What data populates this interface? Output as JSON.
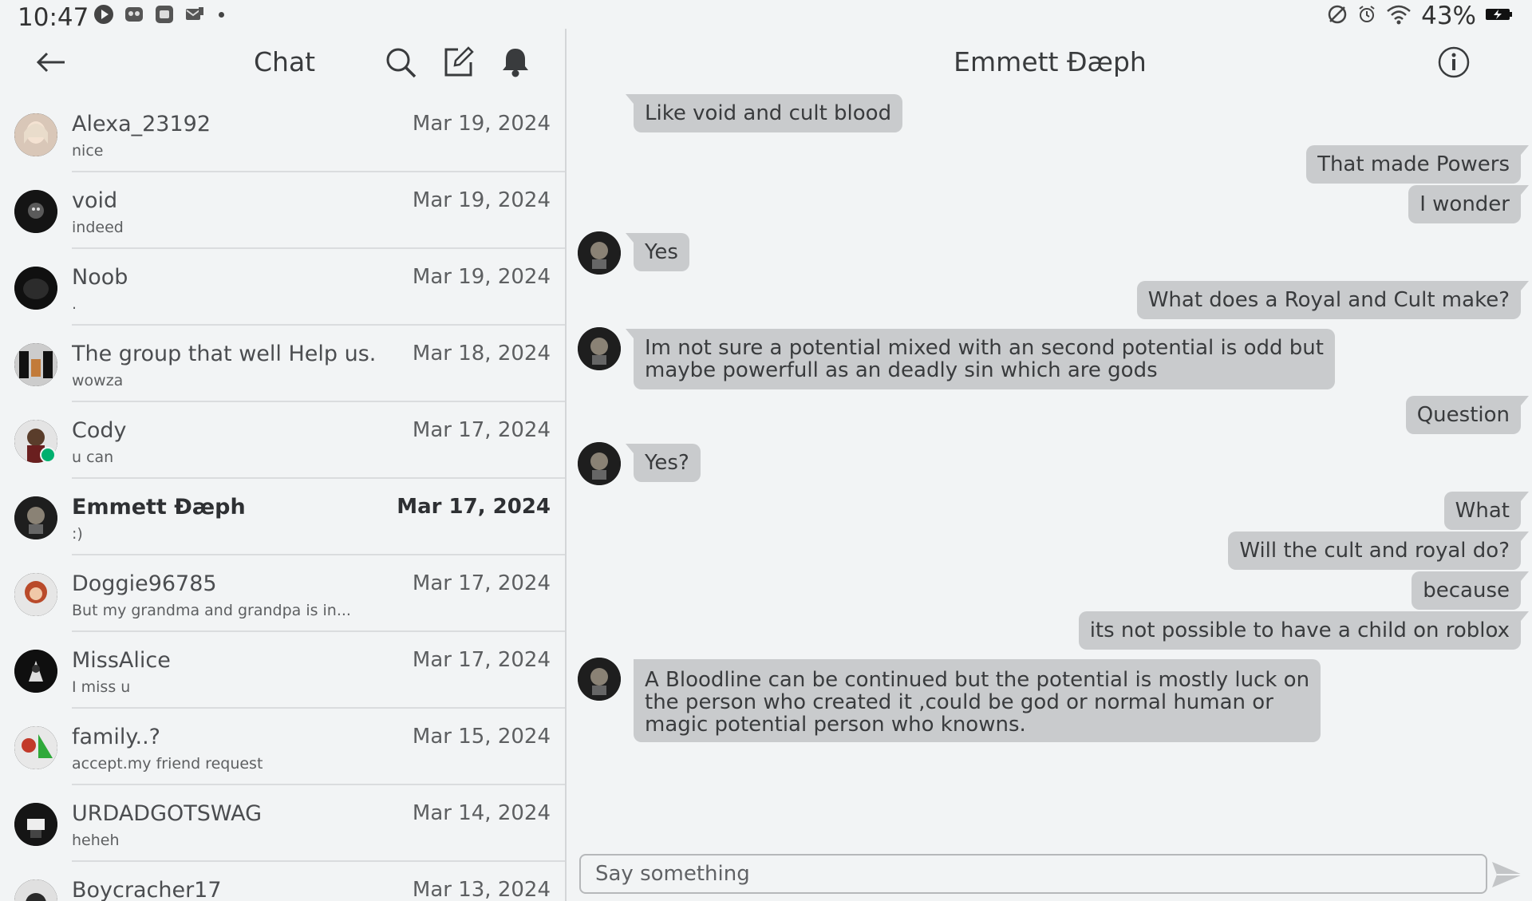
{
  "status_bar": {
    "time": "10:47",
    "battery_percent": "43%",
    "left_icons": [
      "youtube-icon",
      "app-icon",
      "app-icon",
      "mail-icon"
    ],
    "right_icons": [
      "dnd-icon",
      "alarm-icon",
      "wifi-icon",
      "battery-charging-icon"
    ]
  },
  "chat_list": {
    "title": "Chat",
    "conversations": [
      {
        "name": "Alexa_23192",
        "preview": "nice",
        "date": "Mar 19, 2024"
      },
      {
        "name": "void",
        "preview": "indeed",
        "date": "Mar 19, 2024"
      },
      {
        "name": "Noob",
        "preview": ".",
        "date": "Mar 19, 2024"
      },
      {
        "name": "The group that well Help us...",
        "preview": "wowza",
        "date": "Mar 18, 2024"
      },
      {
        "name": "Cody",
        "preview": "u can",
        "date": "Mar 17, 2024",
        "online": true
      },
      {
        "name": "Emmett Ðæph",
        "preview": ":)",
        "date": "Mar 17, 2024",
        "active": true
      },
      {
        "name": "Doggie96785",
        "preview": "But my grandma and grandpa is in...",
        "date": "Mar 17, 2024"
      },
      {
        "name": "MissAlice",
        "preview": "I miss u",
        "date": "Mar 17, 2024"
      },
      {
        "name": "family..?",
        "preview": "accept.my friend request",
        "date": "Mar 15, 2024"
      },
      {
        "name": "URDADGOTSWAG",
        "preview": "heheh",
        "date": "Mar 14, 2024"
      },
      {
        "name": "Boycracher17",
        "preview": "",
        "date": "Mar 13, 2024"
      }
    ]
  },
  "conversation": {
    "title": "Emmett Ðæph",
    "messages": [
      {
        "dir": "in",
        "text": "Like void and cult blood",
        "avatar": false
      },
      {
        "dir": "out",
        "text": "That made Powers"
      },
      {
        "dir": "out",
        "text": "I wonder"
      },
      {
        "dir": "in",
        "text": "Yes",
        "avatar": true
      },
      {
        "dir": "out",
        "text": "What does a Royal and Cult make?"
      },
      {
        "dir": "in",
        "text": "Im not sure a potential mixed with an second potential is odd but",
        "text2": "maybe powerfull as an deadly sin which are gods",
        "avatar": true
      },
      {
        "dir": "out",
        "text": "Question"
      },
      {
        "dir": "in",
        "text": "Yes?",
        "avatar": true
      },
      {
        "dir": "out",
        "text": "What"
      },
      {
        "dir": "out",
        "text": "Will the cult and royal do?"
      },
      {
        "dir": "out",
        "text": "because"
      },
      {
        "dir": "out",
        "text": "its not possible to have a child on roblox"
      },
      {
        "dir": "in",
        "text": "A Bloodline can be continued but the potential is mostly luck on",
        "text2": "the person who created it ,could be god or normal human or",
        "text3": "magic potential person who knowns.",
        "avatar": true
      }
    ],
    "composer_placeholder": "Say something"
  },
  "colors": {
    "background": "#f2f4f5",
    "bubble": "#c9cbcd",
    "online": "#00b06f"
  }
}
